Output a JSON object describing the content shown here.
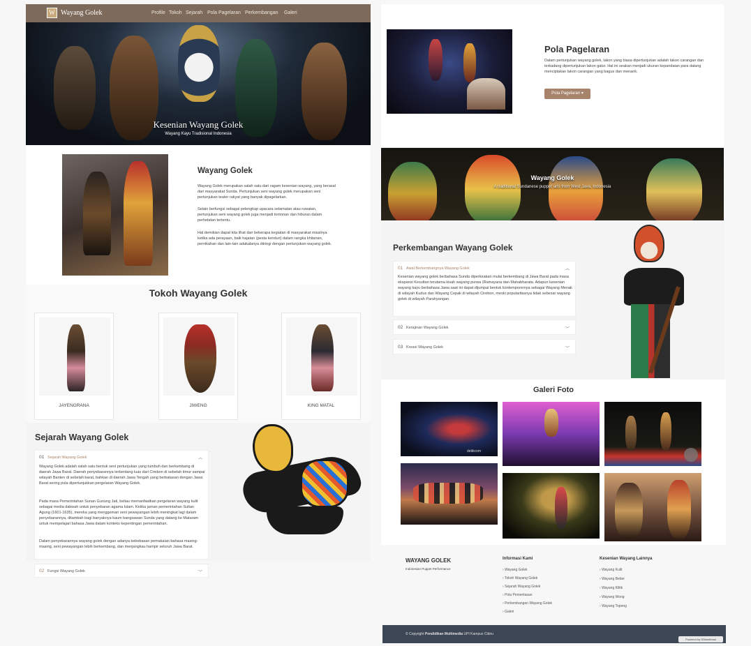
{
  "nav": {
    "brand": "Wayang Golek",
    "logo_letter": "W",
    "items": [
      "Profile",
      "Tokoh",
      "Sejarah",
      "Pola Pagelaran",
      "Perkembangan",
      "Galeri"
    ]
  },
  "hero": {
    "title": "Kesenian Wayang Golek",
    "subtitle": "Wayang Kayu Tradisional Indonesia"
  },
  "profile": {
    "title": "Wayang Golek",
    "p1": "Wayang Golek merupakan salah satu dari ragam kesenian wayang, yang berasal dari masyarakat Sunda. Pertunjukan seni wayang golek merupakan seni pertunjukan teater rakyat yang banyak dipagelarkan.",
    "p2": "Selain berfungsi sebagai pelengkap upacara selamatan atau ruwatan, pertunjukan seni wayang golek juga menjadi tontonan dan hiburan dalam perhelatan tertentu.",
    "p3": "Hal demikian dapat kita lihat dari beberapa kegiatan di masyarakat misalnya ketika ada perayaan, baik hajatan (pesta kenduri) dalam rangka khitanan, pernikahan dan lain-lain adakalanya diiringi dengan pertunjukan wayang golek."
  },
  "tokoh": {
    "title": "Tokoh Wayang Golek",
    "cards": [
      "JAYENGRANA",
      "JIWENG",
      "KING MATAL"
    ]
  },
  "sejarah": {
    "title": "Sejarah Wayang Golek",
    "acc1_num": "01",
    "acc1_title": "Sejarah Wayang Golek",
    "acc1_p1": "Wayang Golek adalah salah satu bentuk seni pertunjukan yang tumbuh dan berkembang di daerah Jawa Barat. Daerah penyebarannya terbentang luas dari Cirebon di sebelah timur sampai wilayah Banten di sebelah barat, bahkan di daerah Jawa Tengah yang berbatasan dengan Jawa Barat sering pula dipertunjukkan pergelaran Wayang Golek.",
    "acc1_p2": "Pada masa Pemerintahan Sunan Gunung Jati, beliau memanfaatkan pergelaran wayang kulit sebagai media dakwah untuk penyebaran agama Islam. Ketika jaman pemerintahan Sultan Agung (1601-1635), mereka yang menggemari seni pewayangan lebih meningkat lagi dalam penyebarannya, ditambah bagi banyaknya kaum bangsawan Sunda yang datang ke Mataram untuk mempelajari bahasa Jawa dalam konteks kepentingan pemerintahan.",
    "acc1_p3": "Dalam penyebarannya wayang golek dengan adanya kebebasan pemakaian bahasa masing-masing, seni pewayangan lebih berkembang, dan menjangkau hampir seluruh Jawa Barat.",
    "acc2_num": "02",
    "acc2_title": "Fungsi Wayang Golek"
  },
  "pola": {
    "title": "Pola Pagelaran",
    "text": "Dalam pertunjukan wayang golek, lakon yang biasa dipertunjukan adalah lakon carangan dan terkadang dipertunjukan lakon galur. Hal ini seakan menjadi ukuran kepandaian para dalang menciptakan lakon carangan yang bagus dan menarik.",
    "button": "Pola Pagelaran"
  },
  "banner": {
    "title": "Wayang Golek",
    "subtitle": "A traditional Sundanese puppet arts from West Java, Indonesia"
  },
  "perkembangan": {
    "title": "Perkembangan Wayang Golek",
    "acc1_num": "01",
    "acc1_title": "Awal Berkembangnya Wayang Golek",
    "acc1_text": "Kesenian wayang golek berbahasa Sunda diperkirakan mulai berkembang di Jawa Barat pada masa ekspansi Kesultan terutama kisah wayang purwa (Ramayana dan Mahabharata. Adapun kesenian wayang kayu berbahasa Jawa saat ini dapat dijumpai bentuk kontemporernya sebagai Wayang Menak di wilayah Kudus dan Wayang Cepak di wilayah Cirebon, meski popularitasnya tidak sebesar wayang golek di wilayah Parahyangan.",
    "acc2_num": "02",
    "acc2_title": "Kerajinan Wayang Golek",
    "acc3_num": "03",
    "acc3_title": "Kreasi Wayang Golek"
  },
  "galeri": {
    "title": "Galeri Foto",
    "watermark": "detikcom"
  },
  "footer": {
    "brand": "WAYANG GOLEK",
    "tagline": "Indonesian Puppet Performance",
    "col1_title": "Informasi Kami",
    "col1_links": [
      "Wayang Golek",
      "Tokoh Wayang Golek",
      "Sejarah Wayang Golek",
      "Pola Pementasan",
      "Perkembangan Wayang Golek",
      "Galeri"
    ],
    "col2_title": "Kesenian Wayang Lainnya",
    "col2_links": [
      "Wayang Kulit",
      "Wayang Beber",
      "Wayang Klitik",
      "Wayang Wong",
      "Wayang Topeng"
    ],
    "copyright_prefix": "© Copyright",
    "copyright_bold": "Pendidikan Multimedia",
    "copyright_suffix": "UPI Kampus Cibiru",
    "badge": "Powered by 000webhost"
  }
}
